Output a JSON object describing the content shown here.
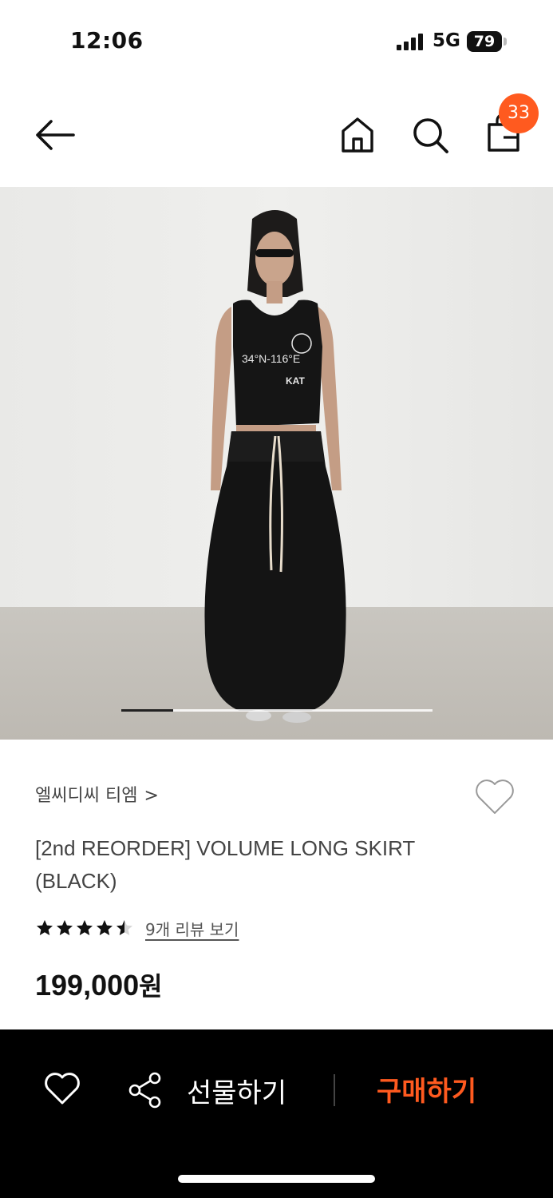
{
  "status_bar": {
    "time": "12:06",
    "network": "5G",
    "battery": "79"
  },
  "nav": {
    "back_icon": "arrow-left-icon",
    "home_icon": "home-icon",
    "search_icon": "search-icon",
    "cart_icon": "shopping-bag-icon",
    "cart_count": "33"
  },
  "gallery": {
    "image_text_line1": "34°N-116°E",
    "image_text_line2": "KAT",
    "progress_fraction": 0.166
  },
  "product": {
    "brand": "엘씨디씨 티엠",
    "brand_chevron": ">",
    "title": "[2nd REORDER] VOLUME LONG SKIRT (BLACK)",
    "rating": 4.5,
    "review_link": "9개 리뷰 보기",
    "price": "199,000",
    "price_unit": "원"
  },
  "bottom_bar": {
    "gift_label": "선물하기",
    "buy_label": "구매하기"
  },
  "colors": {
    "accent": "#ff5a1f",
    "bottom_bar_bg": "#000000",
    "text_primary": "#111111",
    "text_secondary": "#444444"
  }
}
